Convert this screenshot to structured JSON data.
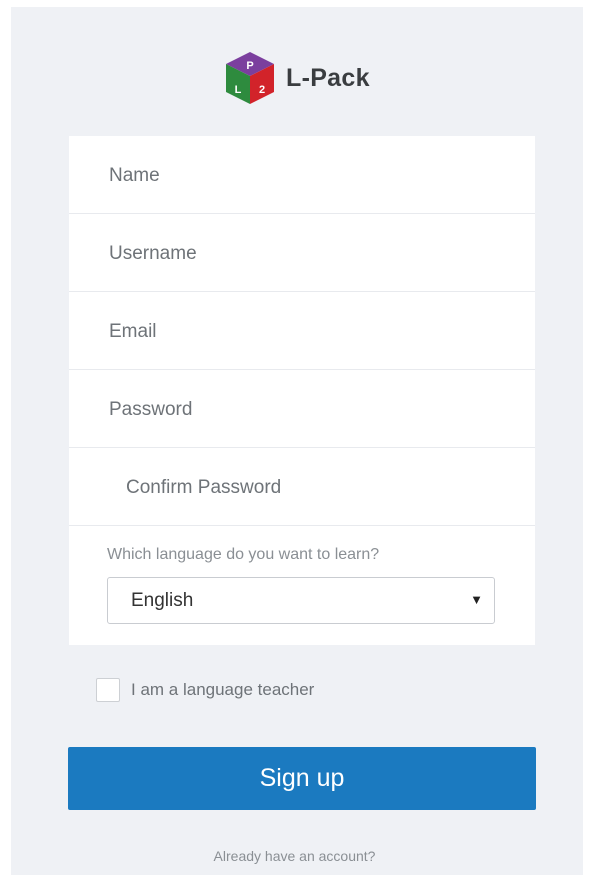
{
  "brand": {
    "name": "L-Pack",
    "logo_letters": [
      "P",
      "L",
      "2"
    ],
    "logo_colors": {
      "top": "#7b3f9e",
      "left": "#2e8b3e",
      "right": "#d2232a"
    }
  },
  "form": {
    "fields": [
      {
        "placeholder": "Name",
        "type": "text"
      },
      {
        "placeholder": "Username",
        "type": "text"
      },
      {
        "placeholder": "Email",
        "type": "email"
      },
      {
        "placeholder": "Password",
        "type": "password"
      },
      {
        "placeholder": "Confirm Password",
        "type": "password"
      }
    ],
    "language_question": "Which language do you want to learn?",
    "language_selected": "English",
    "teacher_label": "I am a language teacher",
    "teacher_checked": false,
    "signup_label": "Sign up",
    "already_account": "Already have an account?"
  },
  "colors": {
    "background": "#eff1f5",
    "primary": "#1b7ac0"
  }
}
